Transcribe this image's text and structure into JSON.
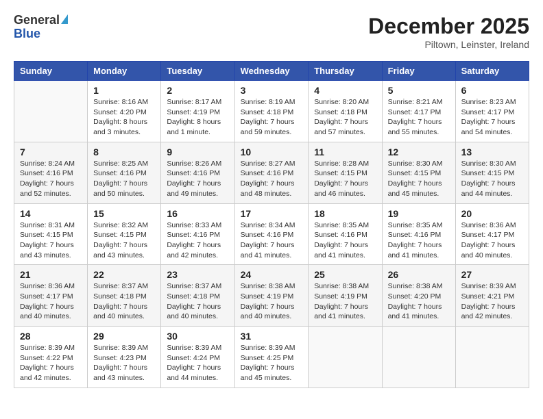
{
  "header": {
    "logo_general": "General",
    "logo_blue": "Blue",
    "month": "December 2025",
    "location": "Piltown, Leinster, Ireland"
  },
  "columns": [
    "Sunday",
    "Monday",
    "Tuesday",
    "Wednesday",
    "Thursday",
    "Friday",
    "Saturday"
  ],
  "weeks": [
    [
      {
        "day": "",
        "info": ""
      },
      {
        "day": "1",
        "info": "Sunrise: 8:16 AM\nSunset: 4:20 PM\nDaylight: 8 hours\nand 3 minutes."
      },
      {
        "day": "2",
        "info": "Sunrise: 8:17 AM\nSunset: 4:19 PM\nDaylight: 8 hours\nand 1 minute."
      },
      {
        "day": "3",
        "info": "Sunrise: 8:19 AM\nSunset: 4:18 PM\nDaylight: 7 hours\nand 59 minutes."
      },
      {
        "day": "4",
        "info": "Sunrise: 8:20 AM\nSunset: 4:18 PM\nDaylight: 7 hours\nand 57 minutes."
      },
      {
        "day": "5",
        "info": "Sunrise: 8:21 AM\nSunset: 4:17 PM\nDaylight: 7 hours\nand 55 minutes."
      },
      {
        "day": "6",
        "info": "Sunrise: 8:23 AM\nSunset: 4:17 PM\nDaylight: 7 hours\nand 54 minutes."
      }
    ],
    [
      {
        "day": "7",
        "info": "Sunrise: 8:24 AM\nSunset: 4:16 PM\nDaylight: 7 hours\nand 52 minutes."
      },
      {
        "day": "8",
        "info": "Sunrise: 8:25 AM\nSunset: 4:16 PM\nDaylight: 7 hours\nand 50 minutes."
      },
      {
        "day": "9",
        "info": "Sunrise: 8:26 AM\nSunset: 4:16 PM\nDaylight: 7 hours\nand 49 minutes."
      },
      {
        "day": "10",
        "info": "Sunrise: 8:27 AM\nSunset: 4:16 PM\nDaylight: 7 hours\nand 48 minutes."
      },
      {
        "day": "11",
        "info": "Sunrise: 8:28 AM\nSunset: 4:15 PM\nDaylight: 7 hours\nand 46 minutes."
      },
      {
        "day": "12",
        "info": "Sunrise: 8:30 AM\nSunset: 4:15 PM\nDaylight: 7 hours\nand 45 minutes."
      },
      {
        "day": "13",
        "info": "Sunrise: 8:30 AM\nSunset: 4:15 PM\nDaylight: 7 hours\nand 44 minutes."
      }
    ],
    [
      {
        "day": "14",
        "info": "Sunrise: 8:31 AM\nSunset: 4:15 PM\nDaylight: 7 hours\nand 43 minutes."
      },
      {
        "day": "15",
        "info": "Sunrise: 8:32 AM\nSunset: 4:15 PM\nDaylight: 7 hours\nand 43 minutes."
      },
      {
        "day": "16",
        "info": "Sunrise: 8:33 AM\nSunset: 4:16 PM\nDaylight: 7 hours\nand 42 minutes."
      },
      {
        "day": "17",
        "info": "Sunrise: 8:34 AM\nSunset: 4:16 PM\nDaylight: 7 hours\nand 41 minutes."
      },
      {
        "day": "18",
        "info": "Sunrise: 8:35 AM\nSunset: 4:16 PM\nDaylight: 7 hours\nand 41 minutes."
      },
      {
        "day": "19",
        "info": "Sunrise: 8:35 AM\nSunset: 4:16 PM\nDaylight: 7 hours\nand 41 minutes."
      },
      {
        "day": "20",
        "info": "Sunrise: 8:36 AM\nSunset: 4:17 PM\nDaylight: 7 hours\nand 40 minutes."
      }
    ],
    [
      {
        "day": "21",
        "info": "Sunrise: 8:36 AM\nSunset: 4:17 PM\nDaylight: 7 hours\nand 40 minutes."
      },
      {
        "day": "22",
        "info": "Sunrise: 8:37 AM\nSunset: 4:18 PM\nDaylight: 7 hours\nand 40 minutes."
      },
      {
        "day": "23",
        "info": "Sunrise: 8:37 AM\nSunset: 4:18 PM\nDaylight: 7 hours\nand 40 minutes."
      },
      {
        "day": "24",
        "info": "Sunrise: 8:38 AM\nSunset: 4:19 PM\nDaylight: 7 hours\nand 40 minutes."
      },
      {
        "day": "25",
        "info": "Sunrise: 8:38 AM\nSunset: 4:19 PM\nDaylight: 7 hours\nand 41 minutes."
      },
      {
        "day": "26",
        "info": "Sunrise: 8:38 AM\nSunset: 4:20 PM\nDaylight: 7 hours\nand 41 minutes."
      },
      {
        "day": "27",
        "info": "Sunrise: 8:39 AM\nSunset: 4:21 PM\nDaylight: 7 hours\nand 42 minutes."
      }
    ],
    [
      {
        "day": "28",
        "info": "Sunrise: 8:39 AM\nSunset: 4:22 PM\nDaylight: 7 hours\nand 42 minutes."
      },
      {
        "day": "29",
        "info": "Sunrise: 8:39 AM\nSunset: 4:23 PM\nDaylight: 7 hours\nand 43 minutes."
      },
      {
        "day": "30",
        "info": "Sunrise: 8:39 AM\nSunset: 4:24 PM\nDaylight: 7 hours\nand 44 minutes."
      },
      {
        "day": "31",
        "info": "Sunrise: 8:39 AM\nSunset: 4:25 PM\nDaylight: 7 hours\nand 45 minutes."
      },
      {
        "day": "",
        "info": ""
      },
      {
        "day": "",
        "info": ""
      },
      {
        "day": "",
        "info": ""
      }
    ]
  ]
}
